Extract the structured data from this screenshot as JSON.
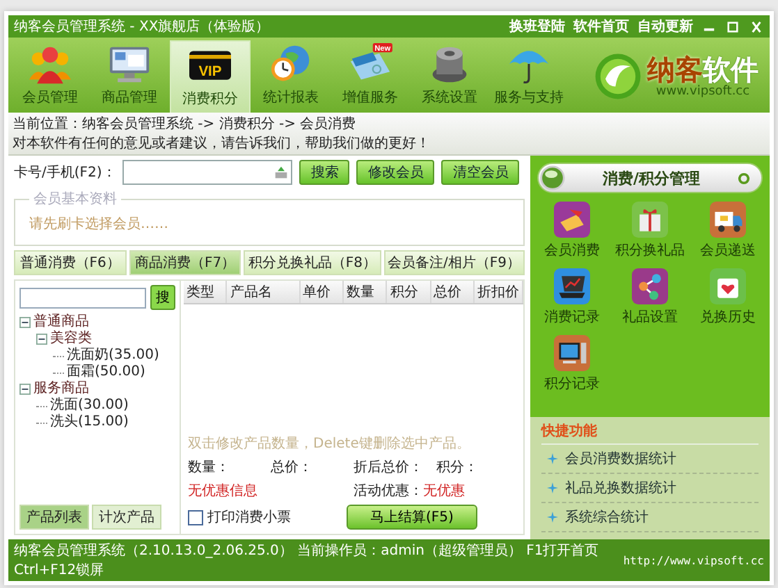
{
  "window": {
    "title": "纳客会员管理系统 - XX旗舰店（体验版）",
    "links": [
      "换班登陆",
      "软件首页",
      "自动更新"
    ]
  },
  "nav": [
    {
      "label": "会员管理",
      "selected": false
    },
    {
      "label": "商品管理",
      "selected": false
    },
    {
      "label": "消费积分",
      "selected": true,
      "icon_text": "VIP"
    },
    {
      "label": "统计报表",
      "selected": false
    },
    {
      "label": "增值服务",
      "selected": false,
      "badge": "New"
    },
    {
      "label": "系统设置",
      "selected": false
    },
    {
      "label": "服务与支持",
      "selected": false
    }
  ],
  "logo": {
    "name": [
      "纳客",
      "软件"
    ],
    "url": "www.vipsoft.cc"
  },
  "breadcrumb": {
    "location": "当前位置：纳客会员管理系统 -> 消费积分 -> 会员消费",
    "feedback": "对本软件有任何的意见或者建议，请告诉我们，帮助我们做的更好！"
  },
  "member_search": {
    "label": "卡号/手机(F2)：",
    "buttons": [
      "搜索",
      "修改会员",
      "清空会员"
    ]
  },
  "member_info": {
    "legend": "会员基本资料",
    "hint": "请先刷卡选择会员……"
  },
  "tabs": [
    {
      "label": "普通消费（F6）",
      "selected": false
    },
    {
      "label": "商品消费（F7）",
      "selected": true
    },
    {
      "label": "积分兑换礼品（F8）",
      "selected": false
    },
    {
      "label": "会员备注/相片（F9）",
      "selected": false
    }
  ],
  "product_search": {
    "button": "搜"
  },
  "tree": [
    {
      "label": "普通商品",
      "expanded": true,
      "children": [
        {
          "label": "美容类",
          "expanded": true,
          "children": [
            {
              "label": "洗面奶(35.00)"
            },
            {
              "label": "面霜(50.00)"
            }
          ]
        }
      ]
    },
    {
      "label": "服务商品",
      "expanded": true,
      "children": [
        {
          "label": "洗面(30.00)"
        },
        {
          "label": "洗头(15.00)"
        }
      ]
    }
  ],
  "list_tabs": [
    {
      "label": "产品列表",
      "selected": true
    },
    {
      "label": "计次产品",
      "selected": false
    }
  ],
  "table": {
    "columns": [
      "类型",
      "产品名",
      "单价",
      "数量",
      "积分",
      "总价",
      "折扣价"
    ]
  },
  "hint": "双击修改产品数量，Delete键删除选中产品。",
  "totals": [
    "数量：",
    "总价：",
    "折后总价：",
    "积分："
  ],
  "discount_info": "无优惠信息",
  "activity": {
    "label": "活动优惠：",
    "value": "无优惠"
  },
  "print_receipt": {
    "label": "打印消费小票",
    "checked": false
  },
  "checkout_button": "马上结算(F5)",
  "panel": {
    "title": "消费/积分管理",
    "items": [
      "会员消费",
      "积分换礼品",
      "会员递送",
      "消费记录",
      "礼品设置",
      "兑换历史",
      "积分记录"
    ]
  },
  "quick": {
    "title": "快捷功能",
    "links": [
      "会员消费数据统计",
      "礼品兑换数据统计",
      "系统综合统计"
    ]
  },
  "status_bar": {
    "text": "纳客会员管理系统（2.10.13.0_2.06.25.0） 当前操作员：admin（超级管理员） F1打开首页 Ctrl+F12锁屏",
    "url": "http://www.vipsoft.cc"
  }
}
